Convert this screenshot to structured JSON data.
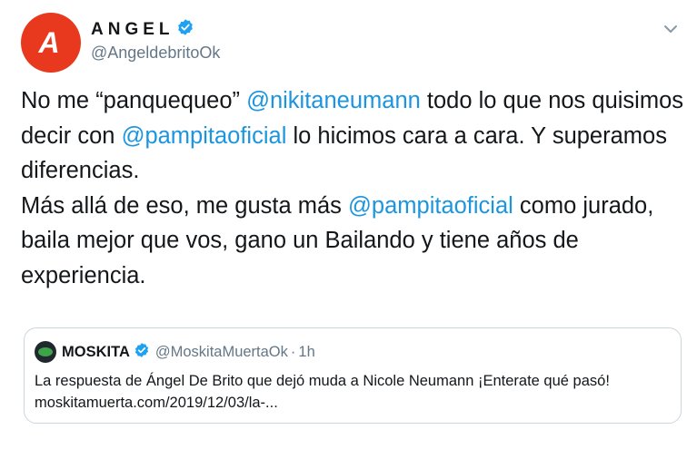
{
  "tweet": {
    "avatar_letter": "A",
    "display_name": "ANGEL",
    "handle": "@AngeldebritoOk",
    "body": {
      "line1_pre": "No me “panquequeo” ",
      "mention1": "@nikitaneumann",
      "line1_post": " todo lo que nos quisimos decir con ",
      "mention2": "@pampitaoficial",
      "line2_post": " lo hicimos cara a cara. Y superamos diferencias.",
      "para2_pre": "Más allá de eso, me gusta más ",
      "mention3": "@pampitaoficial",
      "para2_post": " como jurado, baila mejor que vos, gano un Bailando y tiene años de experiencia."
    }
  },
  "quote": {
    "name": "MOSKITA",
    "handle": "@MoskitaMuertaOk",
    "separator": "·",
    "time": "1h",
    "text": "La respuesta de Ángel De Brito que dejó muda a Nicole Neumann ¡Enterate qué pasó! moskitamuerta.com/2019/12/03/la-..."
  },
  "icons": {
    "verified": "verified-badge-icon",
    "menu": "chevron-down-icon"
  },
  "colors": {
    "avatar_bg": "#e8391e",
    "mention": "#1b95e0",
    "verified": "#1da1f2",
    "secondary_text": "#657786"
  }
}
